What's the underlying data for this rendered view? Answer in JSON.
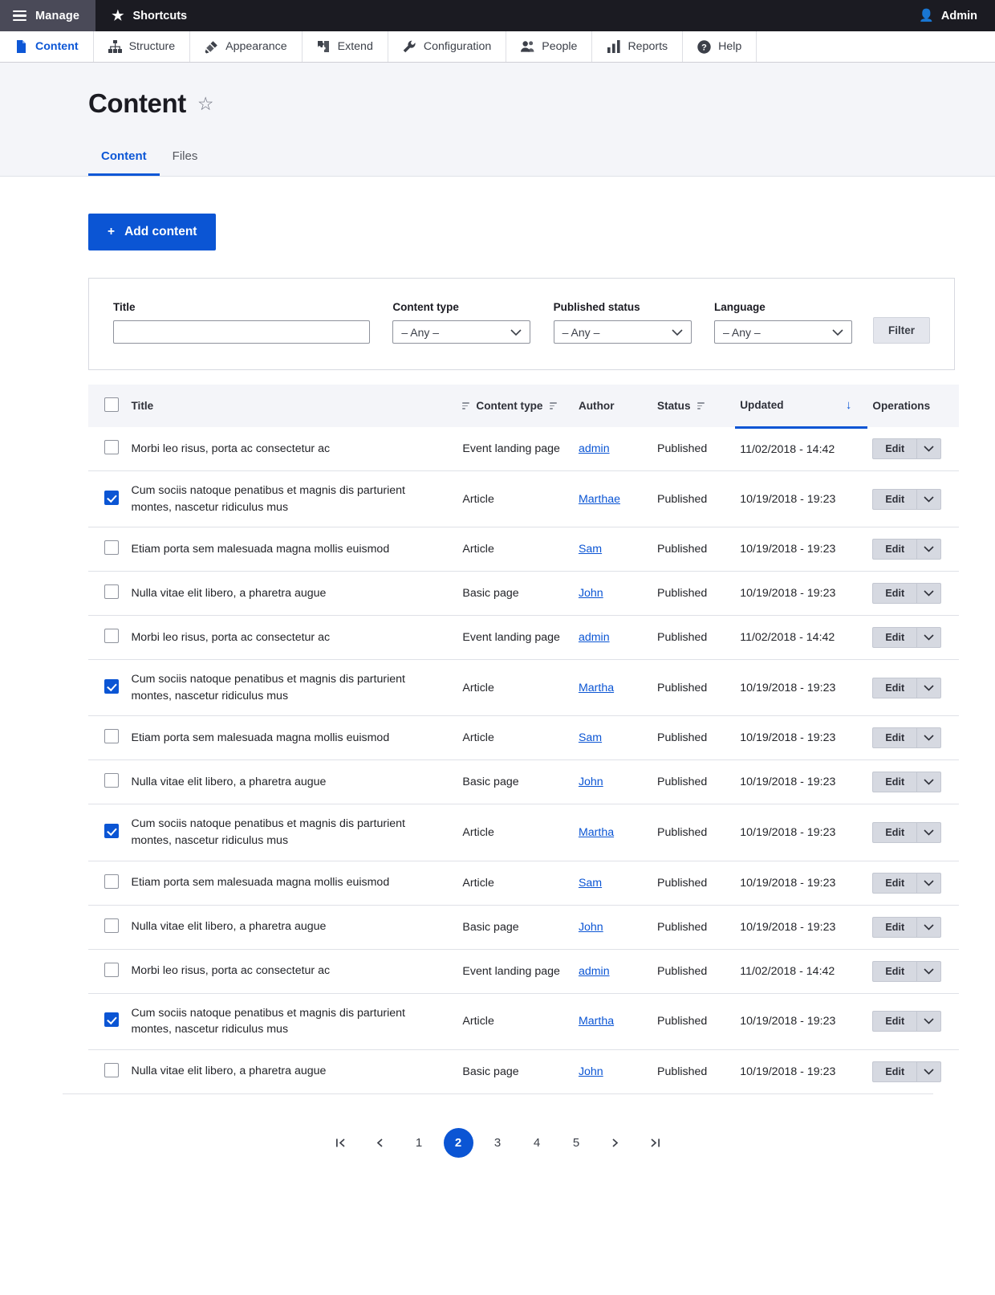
{
  "toolbar": {
    "manage_label": "Manage",
    "shortcuts_label": "Shortcuts",
    "user_label": "Admin",
    "menu": [
      {
        "label": "Content",
        "icon": "document-icon",
        "active": true
      },
      {
        "label": "Structure",
        "icon": "structure-icon",
        "active": false
      },
      {
        "label": "Appearance",
        "icon": "paintbrush-icon",
        "active": false
      },
      {
        "label": "Extend",
        "icon": "puzzle-icon",
        "active": false
      },
      {
        "label": "Configuration",
        "icon": "wrench-icon",
        "active": false
      },
      {
        "label": "People",
        "icon": "people-icon",
        "active": false
      },
      {
        "label": "Reports",
        "icon": "bar-chart-icon",
        "active": false
      },
      {
        "label": "Help",
        "icon": "question-mark-icon",
        "active": false
      }
    ]
  },
  "page": {
    "title": "Content",
    "tabs": [
      {
        "label": "Content",
        "active": true
      },
      {
        "label": "Files",
        "active": false
      }
    ],
    "add_content_label": "Add content",
    "add_content_plus": "+"
  },
  "filters": {
    "title_label": "Title",
    "title_value": "",
    "title_placeholder": "",
    "content_type_label": "Content type",
    "content_type_value": "– Any –",
    "published_status_label": "Published status",
    "published_status_value": "– Any –",
    "language_label": "Language",
    "language_value": "– Any –",
    "filter_button_label": "Filter"
  },
  "table": {
    "columns": {
      "title": "Title",
      "content_type": "Content type",
      "author": "Author",
      "status": "Status",
      "updated": "Updated",
      "operations": "Operations"
    },
    "sort_column": "Updated",
    "sort_direction": "desc",
    "select_all_checked": false,
    "edit_label": "Edit",
    "rows": [
      {
        "checked": false,
        "title": "Morbi leo risus, porta ac consectetur ac",
        "content_type": "Event landing page",
        "author": "admin",
        "status": "Published",
        "updated": "11/02/2018 - 14:42"
      },
      {
        "checked": true,
        "title": "Cum sociis natoque penatibus et magnis dis parturient montes, nascetur ridiculus mus",
        "content_type": "Article",
        "author": "Marthae",
        "status": "Published",
        "updated": "10/19/2018 - 19:23"
      },
      {
        "checked": false,
        "title": "Etiam porta sem malesuada magna mollis euismod",
        "content_type": "Article",
        "author": "Sam",
        "status": "Published",
        "updated": "10/19/2018 - 19:23"
      },
      {
        "checked": false,
        "title": "Nulla vitae elit libero, a pharetra augue",
        "content_type": "Basic page",
        "author": "John",
        "status": "Published",
        "updated": "10/19/2018 - 19:23"
      },
      {
        "checked": false,
        "title": "Morbi leo risus, porta ac consectetur ac",
        "content_type": "Event landing page",
        "author": "admin",
        "status": "Published",
        "updated": "11/02/2018 - 14:42"
      },
      {
        "checked": true,
        "title": "Cum sociis natoque penatibus et magnis dis parturient montes, nascetur ridiculus mus",
        "content_type": "Article",
        "author": "Martha",
        "status": "Published",
        "updated": "10/19/2018 - 19:23"
      },
      {
        "checked": false,
        "title": "Etiam porta sem malesuada magna mollis euismod",
        "content_type": "Article",
        "author": "Sam",
        "status": "Published",
        "updated": "10/19/2018 - 19:23"
      },
      {
        "checked": false,
        "title": "Nulla vitae elit libero, a pharetra augue",
        "content_type": "Basic page",
        "author": "John",
        "status": "Published",
        "updated": "10/19/2018 - 19:23"
      },
      {
        "checked": true,
        "title": "Cum sociis natoque penatibus et magnis dis parturient montes, nascetur ridiculus mus",
        "content_type": "Article",
        "author": "Martha",
        "status": "Published",
        "updated": "10/19/2018 - 19:23"
      },
      {
        "checked": false,
        "title": "Etiam porta sem malesuada magna mollis euismod",
        "content_type": "Article",
        "author": "Sam",
        "status": "Published",
        "updated": "10/19/2018 - 19:23"
      },
      {
        "checked": false,
        "title": "Nulla vitae elit libero, a pharetra augue",
        "content_type": "Basic page",
        "author": "John",
        "status": "Published",
        "updated": "10/19/2018 - 19:23"
      },
      {
        "checked": false,
        "title": "Morbi leo risus, porta ac consectetur ac",
        "content_type": "Event landing page",
        "author": "admin",
        "status": "Published",
        "updated": "11/02/2018 - 14:42"
      },
      {
        "checked": true,
        "title": "Cum sociis natoque penatibus et magnis dis parturient montes, nascetur ridiculus mus",
        "content_type": "Article",
        "author": "Martha",
        "status": "Published",
        "updated": "10/19/2018 - 19:23"
      },
      {
        "checked": false,
        "title": "Nulla vitae elit libero, a pharetra augue",
        "content_type": "Basic page",
        "author": "John",
        "status": "Published",
        "updated": "10/19/2018 - 19:23"
      }
    ]
  },
  "pager": {
    "first_label": "|<",
    "prev_label": "‹",
    "next_label": "›",
    "last_label": ">|",
    "pages": [
      "1",
      "2",
      "3",
      "4",
      "5"
    ],
    "current_page": "2"
  },
  "colors": {
    "accent": "#0b55d4",
    "toolbar_bg": "#1b1b22",
    "manage_bg": "#4a4a58",
    "header_bg": "#f4f5f9"
  }
}
